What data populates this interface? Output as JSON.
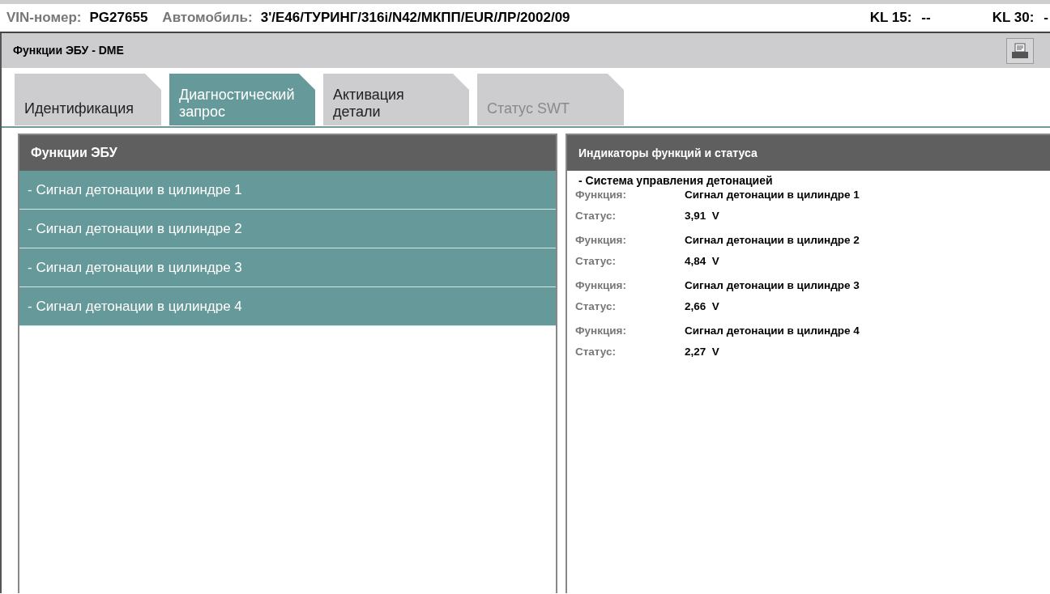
{
  "vehicle_bar": {
    "vin_label": "VIN-номер:",
    "vin": "PG27655",
    "car_label": "Автомобиль:",
    "car": "3'/E46/ТУРИНГ/316i/N42/МКПП/EUR/ЛР/2002/09",
    "kl15_label": "KL 15:",
    "kl15": "--",
    "kl30_label": "KL 30:",
    "kl30": "-"
  },
  "window": {
    "title": "Функции ЭБУ - DME"
  },
  "tabs": [
    {
      "label": "Идентификация",
      "selected": false,
      "disabled": false
    },
    {
      "label": "Диагностический запрос",
      "selected": true,
      "disabled": false
    },
    {
      "label": "Активация детали",
      "selected": false,
      "disabled": false
    },
    {
      "label": "Статус SWT",
      "selected": false,
      "disabled": true
    }
  ],
  "functions_panel": {
    "title": "Функции ЭБУ",
    "items": [
      "- Сигнал детонации в цилиндре 1",
      "- Сигнал детонации в цилиндре 2",
      "- Сигнал детонации в цилиндре 3",
      "- Сигнал детонации в цилиндре 4"
    ]
  },
  "status_panel": {
    "title": "Индикаторы функций и статуса",
    "group": "- Система управления детонацией",
    "entries": [
      {
        "function_label": "Функция:",
        "function": "Сигнал детонации в цилиндре 1",
        "status_label": "Статус:",
        "status": "3,91  V"
      },
      {
        "function_label": "Функция:",
        "function": "Сигнал детонации в цилиндре 2",
        "status_label": "Статус:",
        "status": "4,84  V"
      },
      {
        "function_label": "Функция:",
        "function": "Сигнал детонации в цилиндре 3",
        "status_label": "Статус:",
        "status": "2,66  V"
      },
      {
        "function_label": "Функция:",
        "function": "Сигнал детонации в цилиндре 4",
        "status_label": "Статус:",
        "status": "2,27  V"
      }
    ]
  }
}
